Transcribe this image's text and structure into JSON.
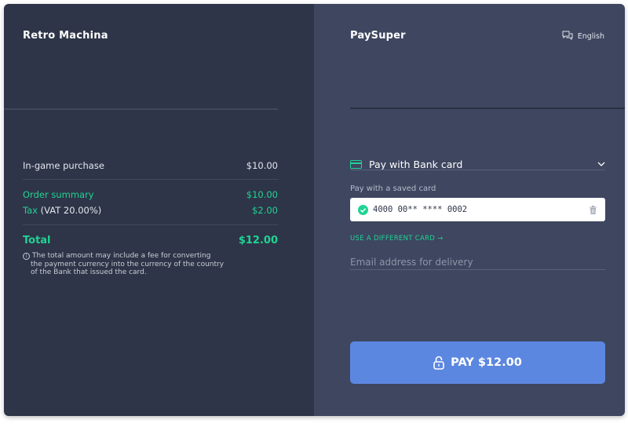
{
  "merchant": {
    "name": "Retro Machina"
  },
  "summary": {
    "item_label": "In-game purchase",
    "item_amount": "$10.00",
    "order_label": "Order summary",
    "order_amount": "$10.00",
    "tax_label": "Tax",
    "tax_detail": "(VAT 20.00%)",
    "tax_amount": "$2.00",
    "total_label": "Total",
    "total_amount": "$12.00",
    "note_lines": [
      "The total amount may include a fee for converting",
      "the payment currency into the currency of the country",
      "of the Bank that issued the card."
    ]
  },
  "provider": {
    "name": "PaySuper",
    "language": "English"
  },
  "payment": {
    "method_label": "Pay with Bank card",
    "saved_label": "Pay with a saved card",
    "saved_card_number": "4000 00** **** 0002",
    "different_card_label": "USE A DIFFERENT CARD →",
    "email_placeholder": "Email address for delivery",
    "pay_button_label": "PAY $12.00"
  },
  "colors": {
    "left_bg": "#2e3548",
    "right_bg": "#3e4660",
    "accent_green": "#20d393",
    "pay_button": "#5c87e0"
  },
  "icons": {
    "language": "chat-bubbles-icon",
    "method": "credit-card-icon",
    "method_toggle": "chevron-down-icon",
    "saved_check": "check-circle-icon",
    "delete": "trash-icon",
    "pay": "lock-icon",
    "note": "info-icon"
  }
}
